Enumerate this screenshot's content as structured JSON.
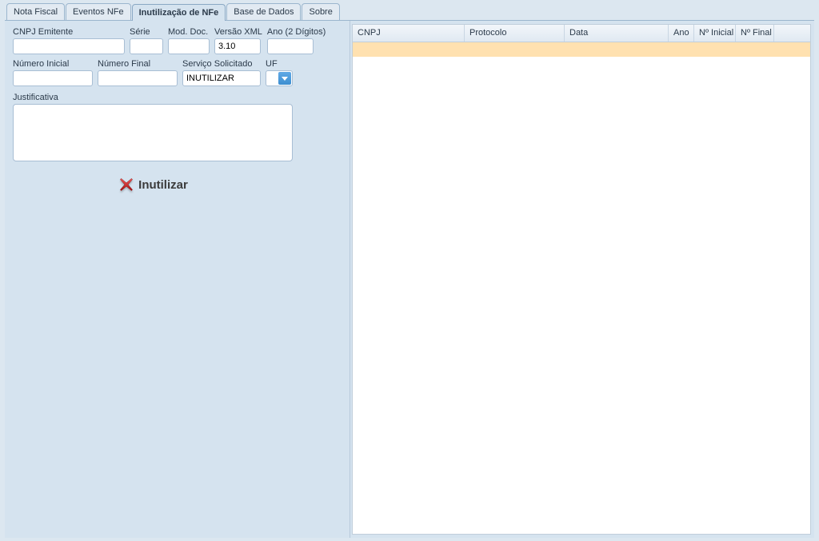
{
  "tabs": [
    {
      "label": "Nota Fiscal"
    },
    {
      "label": "Eventos NFe"
    },
    {
      "label": "Inutilização de NFe"
    },
    {
      "label": "Base de Dados"
    },
    {
      "label": "Sobre"
    }
  ],
  "activeTabIndex": 2,
  "form": {
    "cnpj_label": "CNPJ Emitente",
    "cnpj_value": "",
    "serie_label": "Série",
    "serie_value": "",
    "moddoc_label": "Mod. Doc.",
    "moddoc_value": "",
    "versaoxml_label": "Versão XML",
    "versaoxml_value": "3.10",
    "ano_label": "Ano (2 Dígitos)",
    "ano_value": "",
    "numinicial_label": "Número Inicial",
    "numinicial_value": "",
    "numfinal_label": "Número Final",
    "numfinal_value": "",
    "servico_label": "Serviço Solicitado",
    "servico_value": "INUTILIZAR",
    "uf_label": "UF",
    "uf_value": "",
    "justificativa_label": "Justificativa",
    "justificativa_value": ""
  },
  "button": {
    "inutilizar_label": "Inutilizar"
  },
  "grid": {
    "columns": {
      "cnpj": "CNPJ",
      "protocolo": "Protocolo",
      "data": "Data",
      "ano": "Ano",
      "n_inicial": "Nº Inicial",
      "n_final": "Nº Final"
    },
    "rows": [
      {
        "cnpj": "",
        "protocolo": "",
        "data": "",
        "ano": "",
        "n_inicial": "",
        "n_final": ""
      }
    ]
  }
}
